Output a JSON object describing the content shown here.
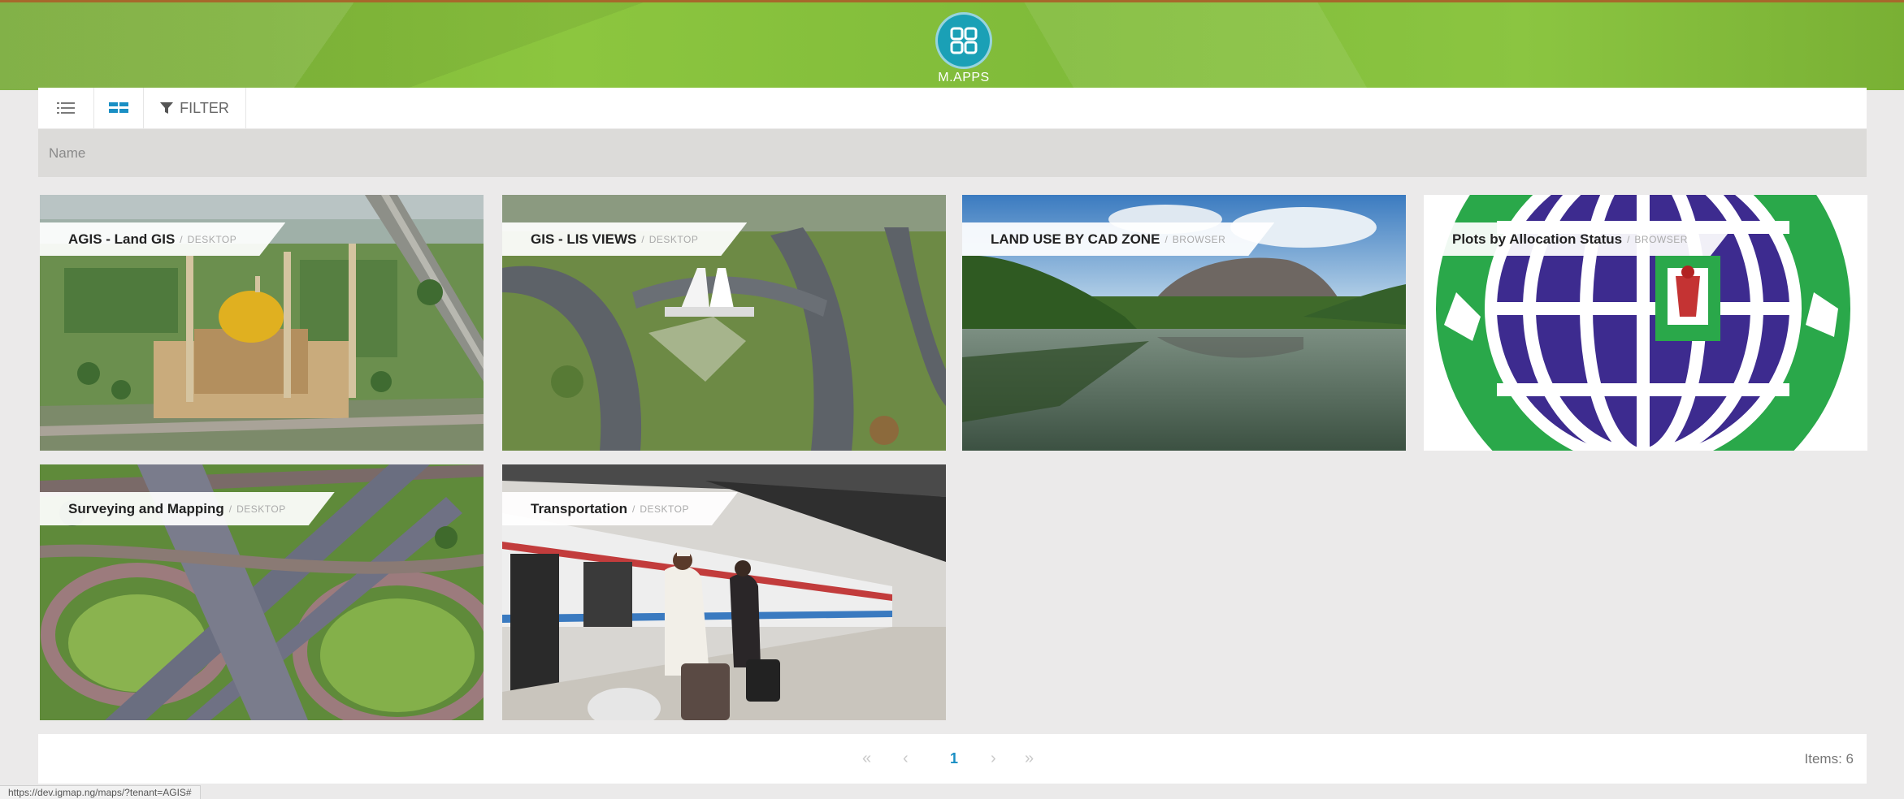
{
  "header": {
    "app_label": "M.APPS",
    "icon": "apps-grid-icon",
    "colors": {
      "bar": "#8cc63f",
      "logo": "#1aa0b6"
    }
  },
  "toolbar": {
    "list_view_icon": "list-view-icon",
    "grid_view_icon": "grid-view-icon",
    "filter_label": "FILTER"
  },
  "search": {
    "placeholder": "Name"
  },
  "apps": [
    {
      "title": "AGIS - Land GIS",
      "sep": "/",
      "type": "DESKTOP"
    },
    {
      "title": "GIS - LIS VIEWS",
      "sep": "/",
      "type": "DESKTOP"
    },
    {
      "title": "LAND USE BY CAD ZONE",
      "sep": "/",
      "type": "BROWSER"
    },
    {
      "title": "Plots by Allocation Status",
      "sep": "/",
      "type": "BROWSER"
    },
    {
      "title": "Surveying and Mapping",
      "sep": "/",
      "type": "DESKTOP"
    },
    {
      "title": "Transportation",
      "sep": "/",
      "type": "DESKTOP"
    }
  ],
  "pagination": {
    "first": "«",
    "prev": "‹",
    "current_page": "1",
    "next": "›",
    "last": "»",
    "items_label": "Items: 6"
  },
  "status_bar": {
    "url": "https://dev.igmap.ng/maps/?tenant=AGIS#"
  }
}
